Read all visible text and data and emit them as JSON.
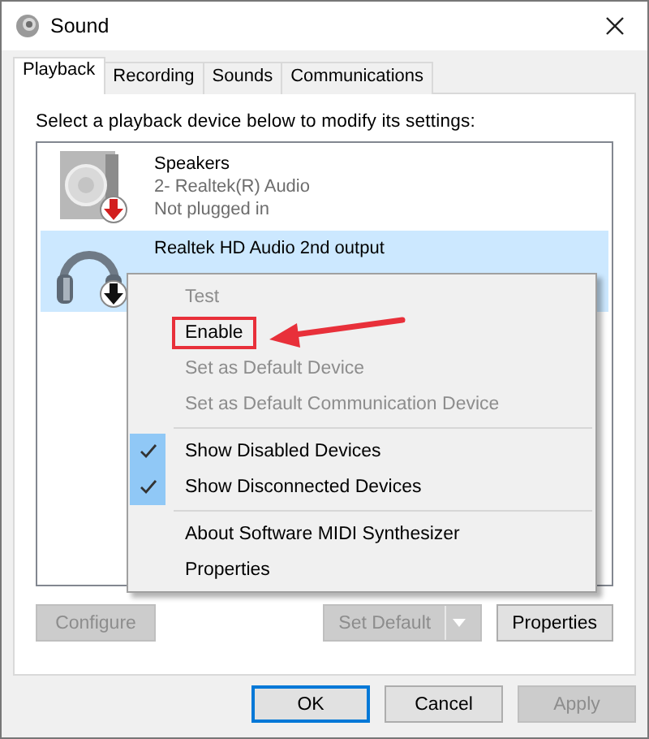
{
  "window": {
    "title": "Sound"
  },
  "tabs": [
    {
      "label": "Playback",
      "selected": true
    },
    {
      "label": "Recording",
      "selected": false
    },
    {
      "label": "Sounds",
      "selected": false
    },
    {
      "label": "Communications",
      "selected": false
    }
  ],
  "instruction": "Select a playback device below to modify its settings:",
  "devices": [
    {
      "name": "Speakers",
      "details": [
        "2- Realtek(R) Audio",
        "Not plugged in"
      ],
      "kind": "speaker",
      "color": "#d21f1f",
      "selected": false
    },
    {
      "name": "Realtek HD Audio 2nd output",
      "kind": "headphones",
      "color": "#111111",
      "selected": true
    }
  ],
  "context_menu": {
    "groups": [
      [
        {
          "label": "Test",
          "disabled": true,
          "checked": false,
          "highlighted": false
        },
        {
          "label": "Enable",
          "disabled": false,
          "checked": false,
          "highlighted": true
        },
        {
          "label": "Set as Default Device",
          "disabled": true,
          "checked": false,
          "highlighted": false
        },
        {
          "label": "Set as Default Communication Device",
          "disabled": true,
          "checked": false,
          "highlighted": false
        }
      ],
      [
        {
          "label": "Show Disabled Devices",
          "disabled": false,
          "checked": true,
          "highlighted": false
        },
        {
          "label": "Show Disconnected Devices",
          "disabled": false,
          "checked": true,
          "highlighted": false
        }
      ],
      [
        {
          "label": "About Software MIDI Synthesizer",
          "disabled": false,
          "checked": false,
          "highlighted": false
        },
        {
          "label": "Properties",
          "disabled": false,
          "checked": false,
          "highlighted": false
        }
      ]
    ]
  },
  "buttons": [
    {
      "label": "Configure",
      "disabled": true,
      "kind": "plain"
    },
    {
      "label": "Set Default",
      "disabled": true,
      "kind": "split"
    },
    {
      "label": "Properties",
      "disabled": false,
      "kind": "plain"
    }
  ],
  "dialog_buttons": [
    {
      "label": "OK",
      "disabled": false,
      "default": true
    },
    {
      "label": "Cancel",
      "disabled": false,
      "default": false
    },
    {
      "label": "Apply",
      "disabled": true,
      "default": false
    }
  ]
}
